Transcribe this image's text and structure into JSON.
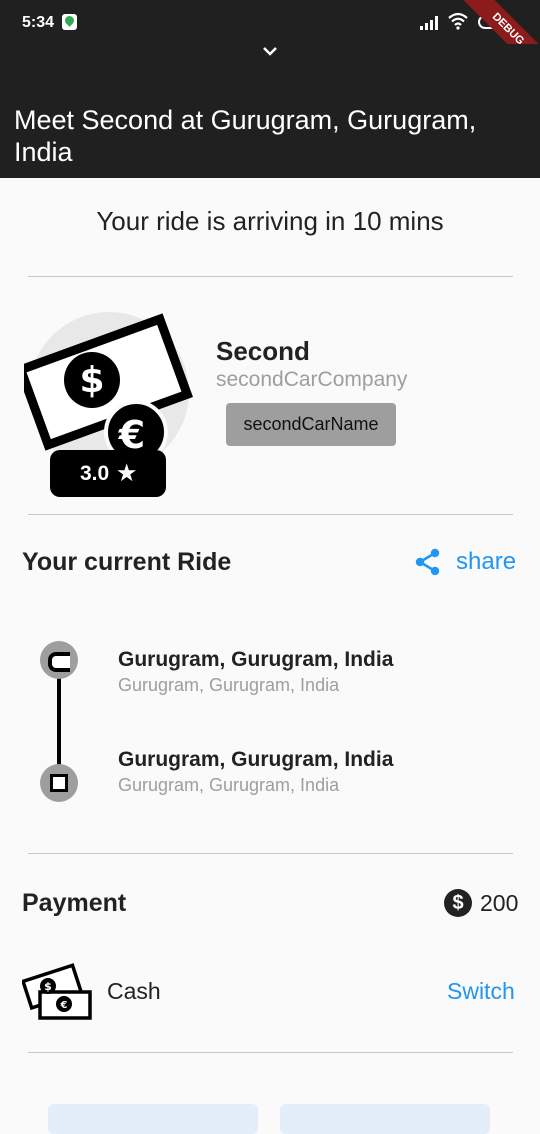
{
  "status_bar": {
    "time": "5:34",
    "debug_label": "DEBUG"
  },
  "appbar": {
    "title": "Meet Second at Gurugram, Gurugram, India",
    "collapse_icon": "chevron-down-icon"
  },
  "ride": {
    "arrival_text": "Your ride is arriving in 10 mins"
  },
  "driver": {
    "name": "Second",
    "company": "secondCarCompany",
    "car_name": "secondCarName",
    "rating": "3.0",
    "rating_icon": "★"
  },
  "current_ride": {
    "title": "Your current Ride",
    "share_label": "share",
    "pickup": {
      "main": "Gurugram, Gurugram, India",
      "sub": "Gurugram, Gurugram, India"
    },
    "dropoff": {
      "main": "Gurugram, Gurugram, India",
      "sub": "Gurugram, Gurugram, India"
    }
  },
  "payment": {
    "title": "Payment",
    "currency_symbol": "$",
    "amount": "200",
    "method": "Cash",
    "switch_label": "Switch"
  },
  "colors": {
    "accent": "#2196f3",
    "appbar": "#202020",
    "grey": "#9e9e9e"
  }
}
